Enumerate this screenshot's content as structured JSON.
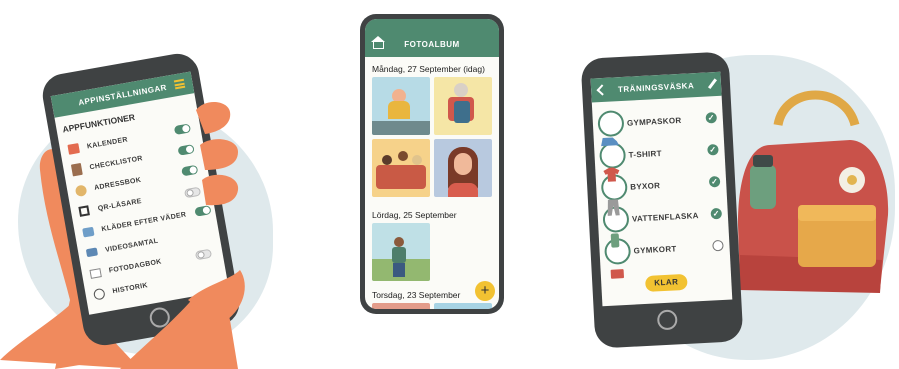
{
  "settings_phone": {
    "title": "APPINSTÄLLNINGAR",
    "section": "APPFUNKTIONER",
    "items": [
      {
        "label": "KALENDER",
        "icon": "calendar-icon",
        "on": true
      },
      {
        "label": "CHECKLISTOR",
        "icon": "checklist-icon",
        "on": true
      },
      {
        "label": "ADRESSBOK",
        "icon": "contact-icon",
        "on": true
      },
      {
        "label": "QR-LÄSARE",
        "icon": "qr-code-icon",
        "on": false
      },
      {
        "label": "KLÄDER EFTER VÄDER",
        "icon": "shirt-icon",
        "on": true
      },
      {
        "label": "VIDEOSAMTAL",
        "icon": "video-icon",
        "on": true
      },
      {
        "label": "FOTODAGBOK",
        "icon": "photo-icon",
        "on": false
      },
      {
        "label": "HISTORIK",
        "icon": "history-icon",
        "on": false
      }
    ]
  },
  "album_phone": {
    "title": "FOTOALBUM",
    "sections": [
      {
        "date": "Måndag, 27 September (idag)"
      },
      {
        "date": "Lördag, 25 September"
      },
      {
        "date": "Torsdag, 23 September"
      }
    ],
    "add_button": "+"
  },
  "checklist_phone": {
    "title": "TRÄNINGSVÄSKA",
    "items": [
      {
        "label": "GYMPASKOR",
        "checked": true
      },
      {
        "label": "T-SHIRT",
        "checked": true
      },
      {
        "label": "BYXOR",
        "checked": true
      },
      {
        "label": "VATTENFLASKA",
        "checked": true
      },
      {
        "label": "GYMKORT",
        "checked": false
      }
    ],
    "done_button": "KLAR"
  },
  "colors": {
    "header_green": "#4f8a70",
    "accent_yellow": "#f2c232",
    "backpack_red": "#c9524a"
  }
}
